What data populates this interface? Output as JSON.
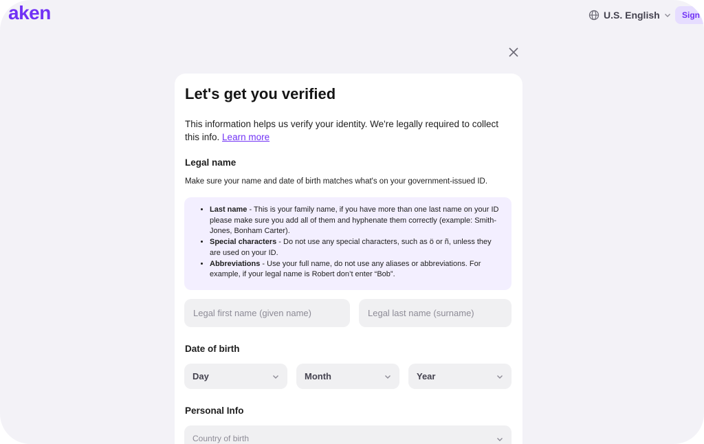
{
  "header": {
    "logo_text": "aken",
    "language_label": "U.S. English",
    "signup_label": "Sign up"
  },
  "modal": {
    "title": "Let's get you verified",
    "intro_text": "This information helps us verify your identity. We're legally required to collect this info.",
    "learn_more_link": "Learn more",
    "legal_name": {
      "label": "Legal name",
      "hint": "Make sure your name and date of birth matches what's on your government-issued ID.",
      "tips": [
        {
          "term": "Last name",
          "text": " - This is your family name, if you have more than one last name on your ID please make sure you add all of them and hyphenate them correctly (example: Smith-Jones, Bonham Carter)."
        },
        {
          "term": "Special characters",
          "text": " - Do not use any special characters, such as ö or ñ, unless they are used on your ID."
        },
        {
          "term": "Abbreviations",
          "text": " - Use your full name, do not use any aliases or abbreviations. For example, if your legal name is Robert don’t enter “Bob”."
        }
      ],
      "first_name_placeholder": "Legal first name (given name)",
      "last_name_placeholder": "Legal last name (surname)"
    },
    "date_of_birth": {
      "label": "Date of birth",
      "day": "Day",
      "month": "Month",
      "year": "Year"
    },
    "personal_info": {
      "label": "Personal Info",
      "country_placeholder": "Country of birth"
    }
  },
  "colors": {
    "brand": "#7132f5",
    "page_background": "#f3f2f7",
    "info_box": "#f3efff",
    "field_background": "#f0f0f2"
  },
  "icons": [
    "globe-icon",
    "chevron-down-icon",
    "close-icon"
  ]
}
